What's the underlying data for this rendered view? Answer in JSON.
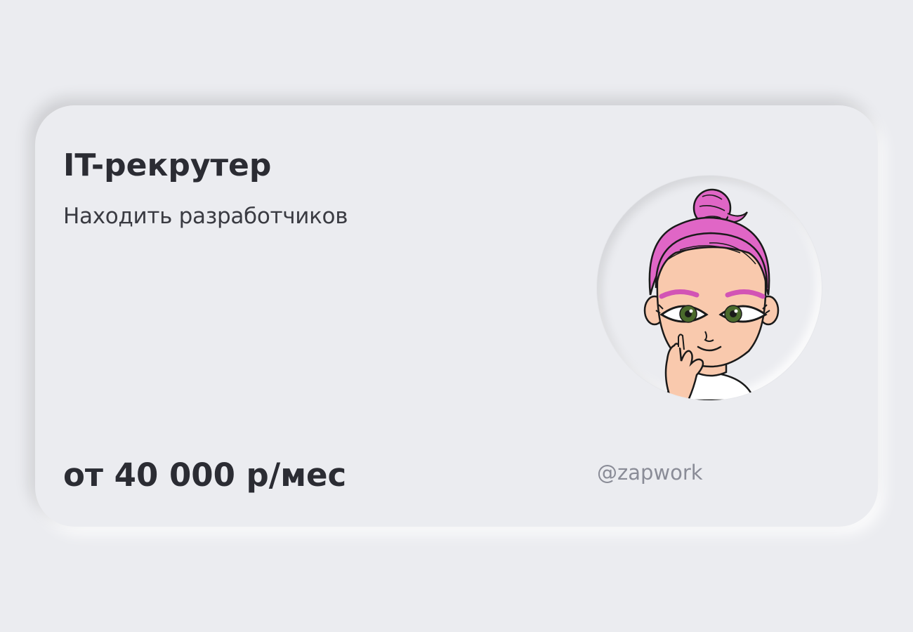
{
  "card": {
    "title": "IT-рекрутер",
    "subtitle": "Находить разработчиков",
    "price": "от 40 000 р/мес",
    "handle": "@zapwork"
  },
  "avatar": {
    "icon": "recruiter-girl-avatar",
    "hair_color": "#e066c6",
    "skin_color": "#f9c9ad",
    "eye_color": "#4a6a2c"
  },
  "colors": {
    "background": "#ebecf0",
    "text_primary": "#2b2c33",
    "text_secondary": "#3a3b42",
    "text_muted": "#8a8c97"
  }
}
